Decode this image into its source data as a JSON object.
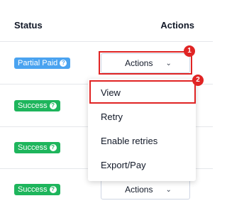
{
  "header": {
    "status": "Status",
    "actions": "Actions"
  },
  "rows": [
    {
      "status": "Partial Paid",
      "badge_color": "#4aa3f0"
    },
    {
      "status": "Success",
      "badge_color": "#1eb55c"
    },
    {
      "status": "Success",
      "badge_color": "#1eb55c"
    },
    {
      "status": "Success",
      "badge_color": "#1eb55c"
    }
  ],
  "action_button_label": "Actions",
  "badge_help_glyph": "?",
  "chevron_glyph": "⌄",
  "menu": {
    "items": [
      "View",
      "Retry",
      "Enable retries",
      "Export/Pay"
    ]
  },
  "markers": {
    "first": "1",
    "second": "2"
  },
  "icons": {
    "help": "question-circle-icon",
    "chevron": "chevron-down-icon"
  },
  "highlight_color": "#e02424"
}
